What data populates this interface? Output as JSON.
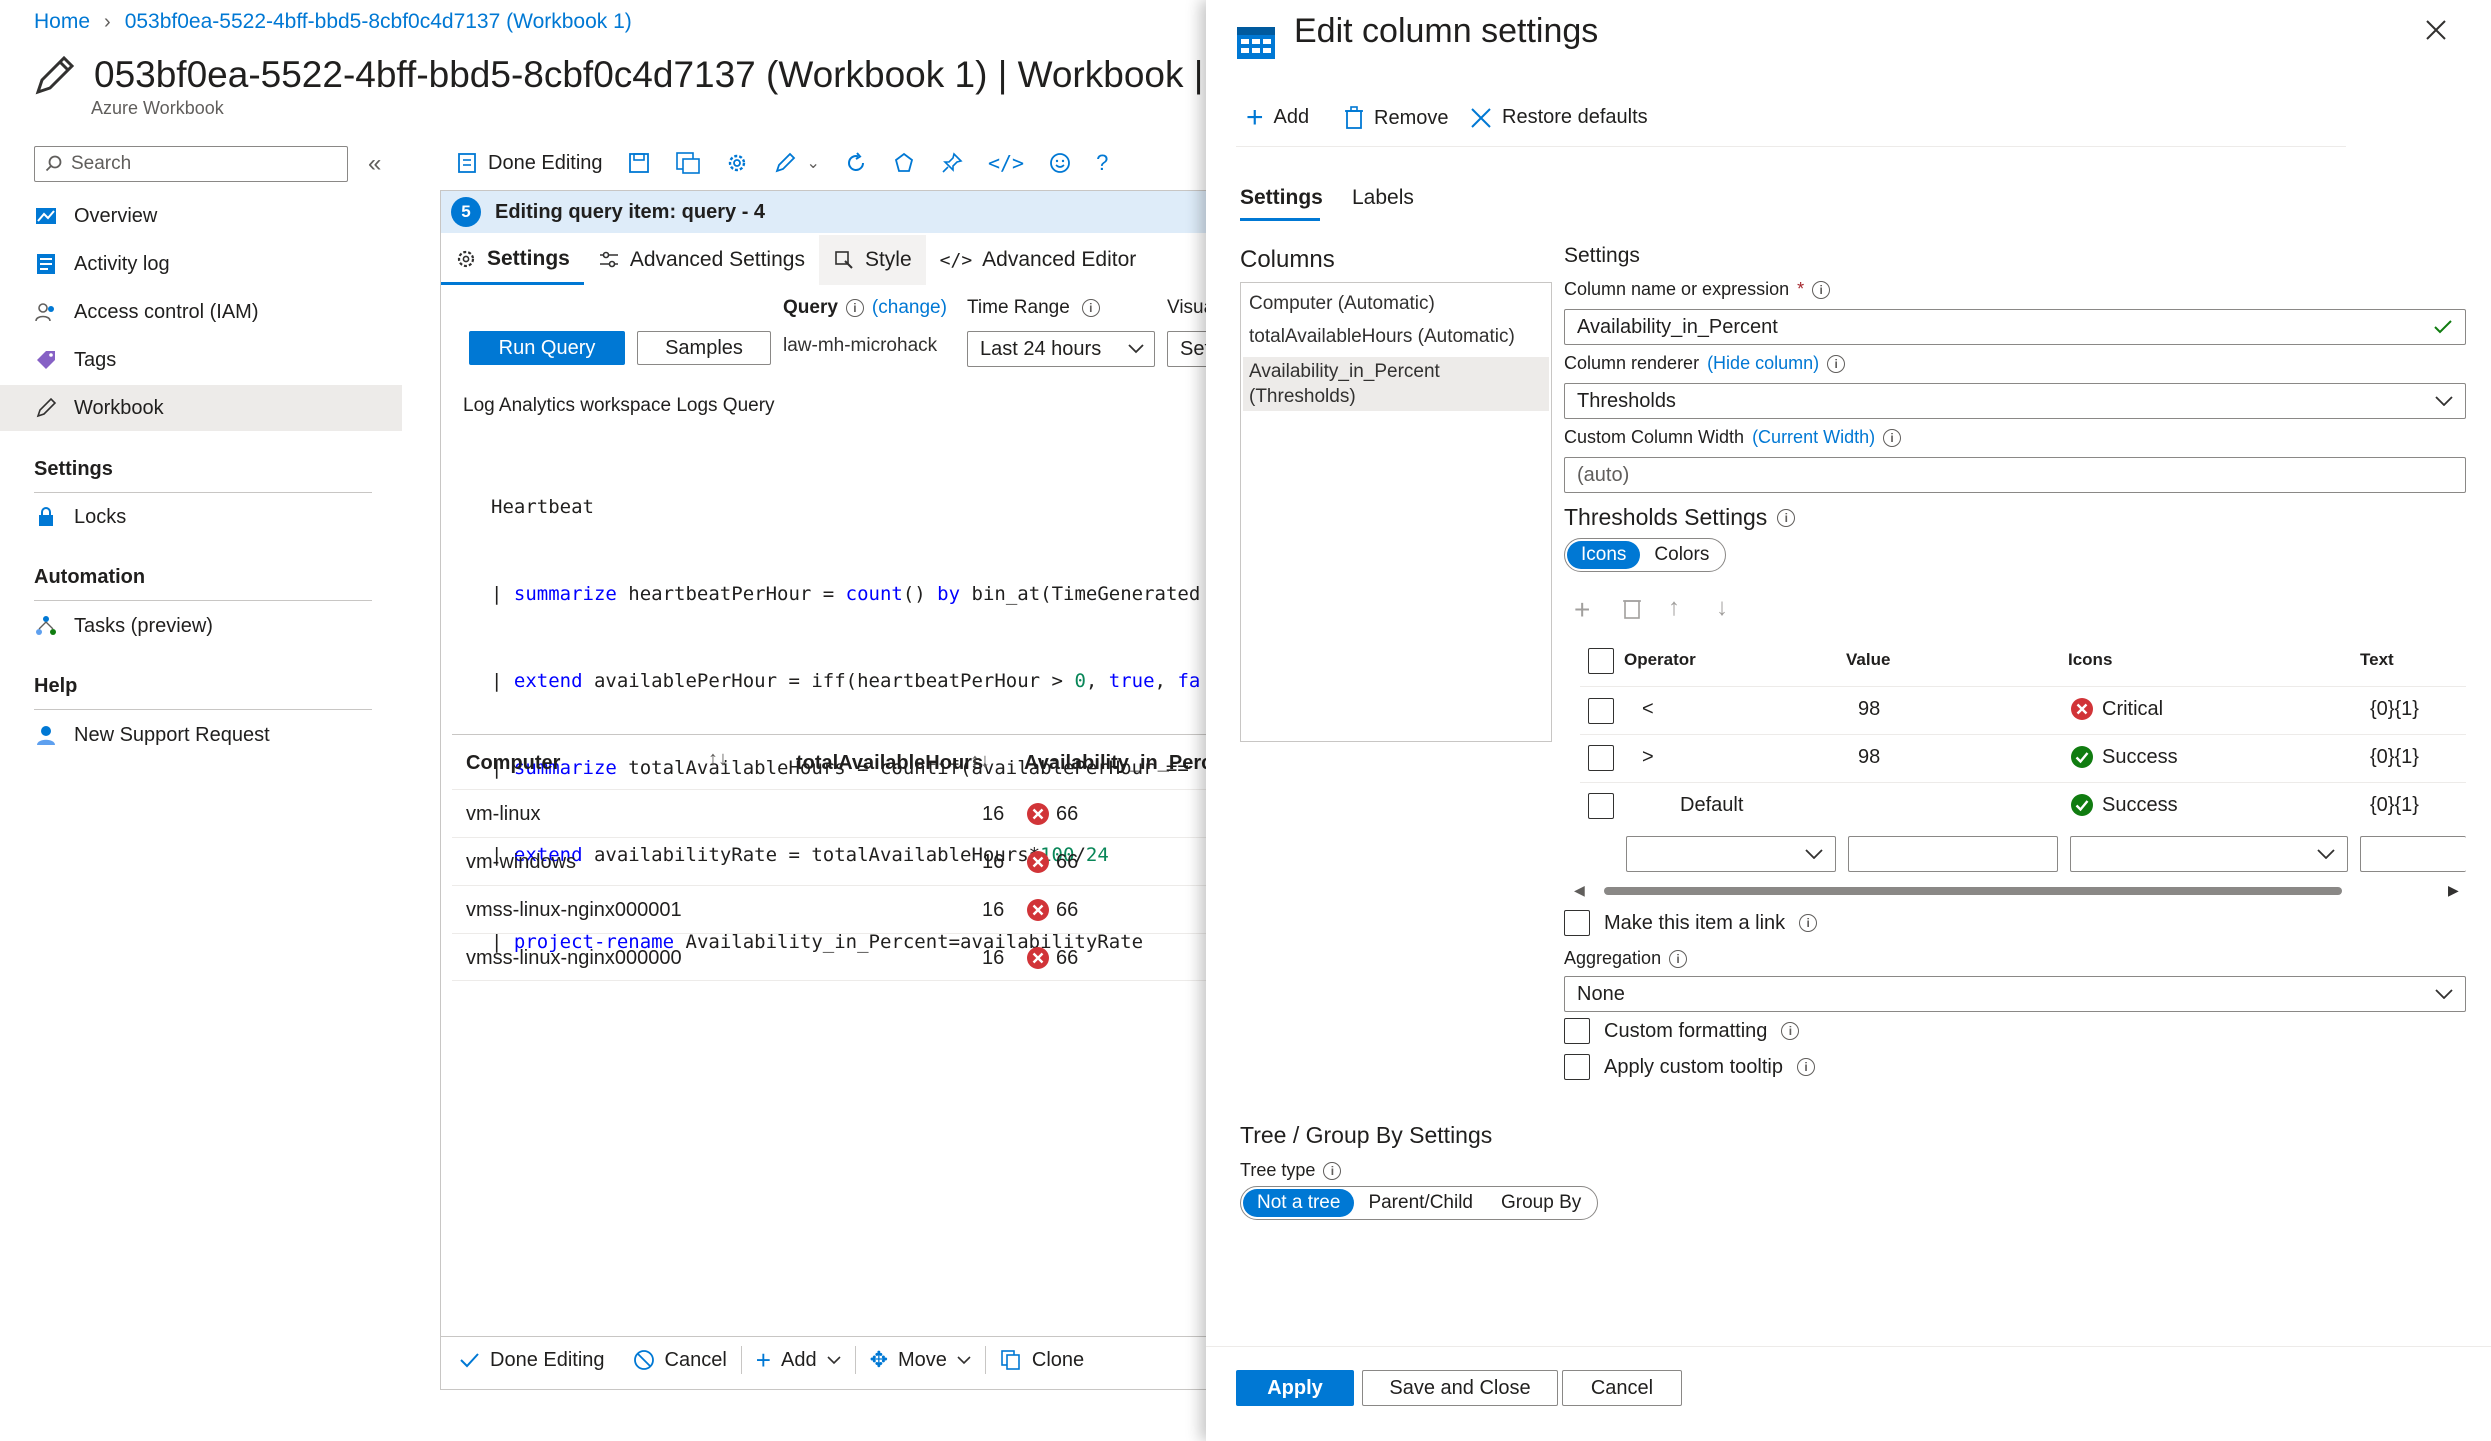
{
  "breadcrumb": {
    "home": "Home",
    "current": "053bf0ea-5522-4bff-bbd5-8cbf0c4d7137 (Workbook 1)"
  },
  "page": {
    "title": "053bf0ea-5522-4bff-bbd5-8cbf0c4d7137 (Workbook 1) | Workbook |",
    "subtitle": "Azure Workbook"
  },
  "sidebar": {
    "search_placeholder": "Search",
    "items": [
      {
        "label": "Overview",
        "icon": "overview-icon"
      },
      {
        "label": "Activity log",
        "icon": "activity-log-icon"
      },
      {
        "label": "Access control (IAM)",
        "icon": "people-icon"
      },
      {
        "label": "Tags",
        "icon": "tag-icon"
      },
      {
        "label": "Workbook",
        "icon": "pencil-icon"
      }
    ],
    "sections": [
      {
        "title": "Settings",
        "items": [
          {
            "label": "Locks",
            "icon": "lock-icon"
          }
        ]
      },
      {
        "title": "Automation",
        "items": [
          {
            "label": "Tasks (preview)",
            "icon": "tasks-icon"
          }
        ]
      },
      {
        "title": "Help",
        "items": [
          {
            "label": "New Support Request",
            "icon": "support-icon"
          }
        ]
      }
    ]
  },
  "toolbar": {
    "done_editing": "Done Editing"
  },
  "editor": {
    "step": "5",
    "header": "Editing query item: query - 4",
    "tabs": [
      "Settings",
      "Advanced Settings",
      "Style",
      "Advanced Editor"
    ],
    "query_label": "Query",
    "change_link": "(change)",
    "time_range_label": "Time Range",
    "visual_label": "Visua",
    "run_query": "Run Query",
    "samples": "Samples",
    "workspace": "law-mh-microhack",
    "time_range_value": "Last 24 hours",
    "visual_value": "Set",
    "query_title": "Log Analytics workspace Logs Query",
    "code_lines": [
      "Heartbeat",
      "| summarize heartbeatPerHour = count() by bin_at(TimeGenerated",
      "| extend availablePerHour = iff(heartbeatPerHour > 0, true, fa",
      "| summarize totalAvailableHours = countif(availablePerHour ==",
      "| extend availabilityRate = totalAvailableHours*100/24",
      "| project-rename Availability_in_Percent=availabilityRate"
    ]
  },
  "results": {
    "columns": [
      "Computer",
      "totalAvailableHours",
      "Availability_in_Percen"
    ],
    "rows": [
      {
        "computer": "vm-linux",
        "hours": "16",
        "availability": "66"
      },
      {
        "computer": "vm-windows",
        "hours": "16",
        "availability": "66"
      },
      {
        "computer": "vmss-linux-nginx000001",
        "hours": "16",
        "availability": "66"
      },
      {
        "computer": "vmss-linux-nginx000000",
        "hours": "16",
        "availability": "66"
      }
    ]
  },
  "bottom_bar": {
    "done_editing": "Done Editing",
    "cancel": "Cancel",
    "add": "Add",
    "move": "Move",
    "clone": "Clone"
  },
  "panel": {
    "title": "Edit column settings",
    "commands": {
      "add": "Add",
      "remove": "Remove",
      "restore": "Restore defaults"
    },
    "tabs": [
      "Settings",
      "Labels"
    ],
    "columns_title": "Columns",
    "columns": [
      "Computer (Automatic)",
      "totalAvailableHours (Automatic)",
      "Availability_in_Percent",
      "(Thresholds)"
    ],
    "settings_title": "Settings",
    "column_name_label": "Column name or expression",
    "required_mark": "*",
    "column_name_value": "Availability_in_Percent",
    "renderer_label": "Column renderer",
    "hide_column_link": "(Hide column)",
    "renderer_value": "Thresholds",
    "width_label": "Custom Column Width",
    "current_width_link": "(Current Width)",
    "width_placeholder": "(auto)",
    "thresholds_title": "Thresholds Settings",
    "threshold_toggle": [
      "Icons",
      "Colors"
    ],
    "threshold_headers": [
      "Operator",
      "Value",
      "Icons",
      "Text"
    ],
    "thresholds": [
      {
        "operator": "<",
        "value": "98",
        "icon": "Critical",
        "text": "{0}{1}",
        "status": "critical"
      },
      {
        "operator": ">",
        "value": "98",
        "icon": "Success",
        "text": "{0}{1}",
        "status": "success"
      },
      {
        "operator": "Default",
        "value": "",
        "icon": "Success",
        "text": "{0}{1}",
        "status": "success"
      }
    ],
    "make_link_label": "Make this item a link",
    "aggregation_label": "Aggregation",
    "aggregation_value": "None",
    "custom_formatting_label": "Custom formatting",
    "custom_tooltip_label": "Apply custom tooltip",
    "tree_title": "Tree / Group By Settings",
    "tree_type_label": "Tree type",
    "tree_options": [
      "Not a tree",
      "Parent/Child",
      "Group By"
    ],
    "apply": "Apply",
    "save_close": "Save and Close",
    "cancel": "Cancel"
  },
  "colors": {
    "accent": "#0078d4",
    "critical": "#d13438",
    "success": "#107c10"
  }
}
